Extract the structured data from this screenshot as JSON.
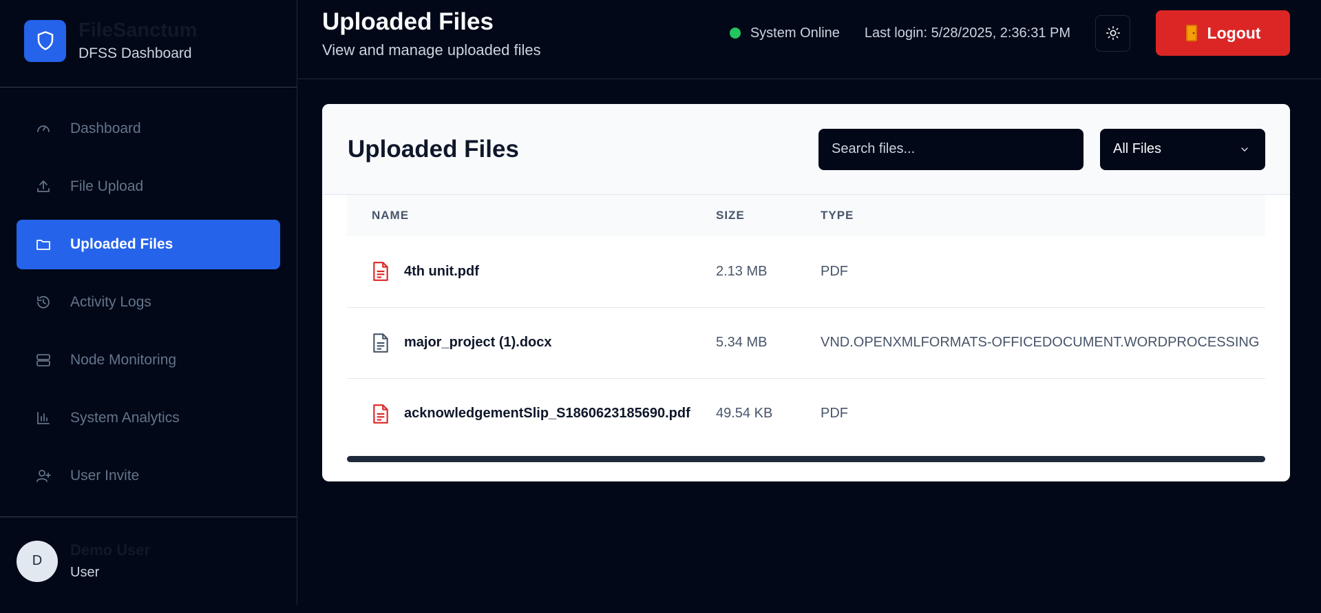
{
  "brand": {
    "title": "FileSanctum",
    "subtitle": "DFSS Dashboard"
  },
  "nav": {
    "items": [
      {
        "label": "Dashboard",
        "icon": "gauge-icon"
      },
      {
        "label": "File Upload",
        "icon": "upload-icon"
      },
      {
        "label": "Uploaded Files",
        "icon": "folder-icon",
        "active": true
      },
      {
        "label": "Activity Logs",
        "icon": "history-icon"
      },
      {
        "label": "Node Monitoring",
        "icon": "server-icon"
      },
      {
        "label": "System Analytics",
        "icon": "bar-chart-icon"
      },
      {
        "label": "User Invite",
        "icon": "user-plus-icon"
      }
    ]
  },
  "user": {
    "initial": "D",
    "name": "Demo User",
    "role": "User"
  },
  "header": {
    "title": "Uploaded Files",
    "subtitle": "View and manage uploaded files",
    "status": "System Online",
    "last_login": "Last login: 5/28/2025, 2:36:31 PM",
    "logout_label": "Logout"
  },
  "card": {
    "title": "Uploaded Files",
    "search_placeholder": "Search files...",
    "filter_value": "All Files",
    "columns": [
      "NAME",
      "SIZE",
      "TYPE"
    ],
    "rows": [
      {
        "name": "4th unit.pdf",
        "size": "2.13 MB",
        "type": "PDF",
        "icon": "pdf-file-icon"
      },
      {
        "name": "major_project (1).docx",
        "size": "5.34 MB",
        "type": "VND.OPENXMLFORMATS-OFFICEDOCUMENT.WORDPROCESSING",
        "icon": "document-file-icon"
      },
      {
        "name": "acknowledgementSlip_S1860623185690.pdf",
        "size": "49.54 KB",
        "type": "PDF",
        "icon": "pdf-file-icon"
      }
    ]
  },
  "colors": {
    "background": "#020817",
    "accent": "#2563eb",
    "danger": "#dc2626",
    "online": "#22c55e",
    "pdf_icon": "#dc2626",
    "doc_icon": "#475569"
  }
}
